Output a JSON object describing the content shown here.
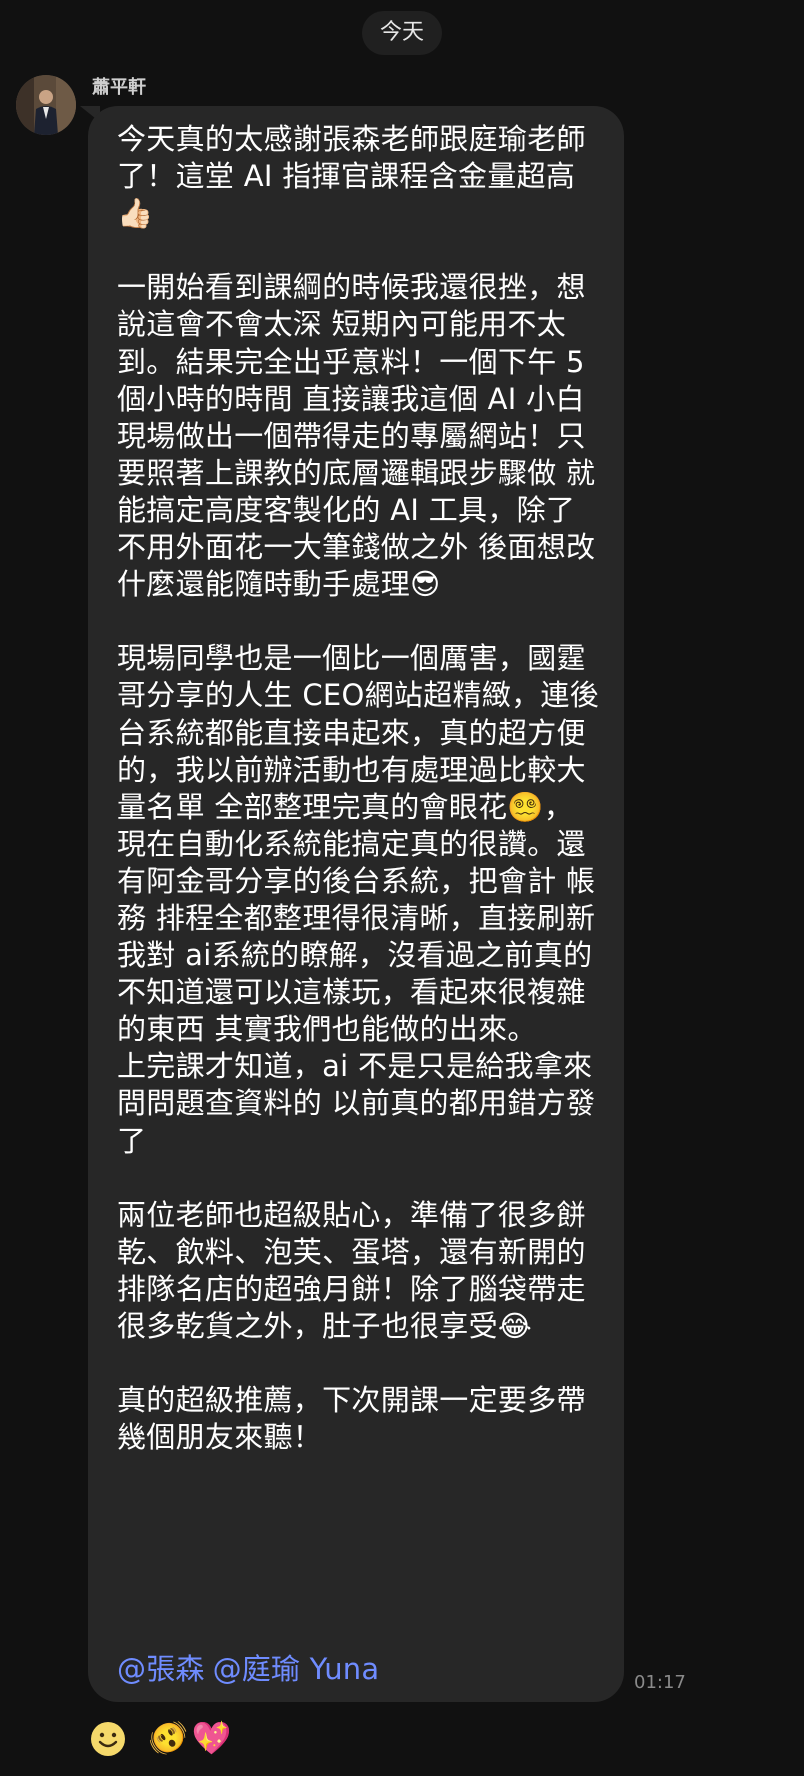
{
  "date_divider": "今天",
  "sender": {
    "name": "蕭平軒"
  },
  "message": {
    "text": "今天真的太感謝張森老師跟庭瑜老師了！這堂 AI 指揮官課程含金量超高👍🏻\n\n一開始看到課綱的時候我還很挫，想說這會不會太深 短期內可能用不太到。結果完全出乎意料！一個下午 5 個小時的時間 直接讓我這個 AI 小白現場做出一個帶得走的專屬網站！只要照著上課教的底層邏輯跟步驟做 就能搞定高度客製化的 AI 工具，除了不用外面花一大筆錢做之外 後面想改什麼還能隨時動手處理😎\n\n現場同學也是一個比一個厲害，國霆哥分享的人生 CEO網站超精緻，連後台系統都能直接串起來，真的超方便的，我以前辦活動也有處理過比較大量名單 全部整理完真的會眼花😵‍💫，現在自動化系統能搞定真的很讚。還有阿金哥分享的後台系統，把會計 帳務 排程全都整理得很清晰，直接刷新我對 ai系統的瞭解，沒看過之前真的不知道還可以這樣玩，看起來很複雜的東西 其實我們也能做的出來。\n上完課才知道，ai 不是只是給我拿來問問題查資料的 以前真的都用錯方發了\n\n兩位老師也超級貼心，準備了很多餅乾、飲料、泡芙、蛋塔，還有新開的排隊名店的超強月餅！除了腦袋帶走很多乾貨之外，肚子也很享受😂\n\n真的超級推薦，下次開課一定要多帶幾個朋友來聽！",
    "mentions": [
      "@張森",
      "@庭瑜 Yuna"
    ],
    "timestamp": "01:17"
  },
  "reactions": {
    "add_reaction_icon": "smiley-icon",
    "items": [
      "🫨",
      "💖"
    ]
  },
  "colors": {
    "background": "#111111",
    "bubble": "#272727",
    "mention": "#6f8cff",
    "timestamp": "#8a8a8a"
  }
}
